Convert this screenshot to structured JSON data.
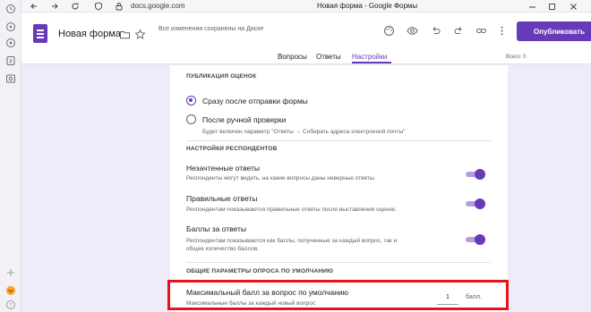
{
  "browser": {
    "url": "docs.google.com",
    "window_title": "Новая форма - Google Формы",
    "nav_icons": [
      "back-icon",
      "forward-icon",
      "refresh-icon",
      "shield-icon",
      "lock-icon"
    ],
    "sidebar_icons": [
      "history-icon",
      "messenger-icon",
      "play-icon",
      "bookmark-icon",
      "screenshot-icon",
      "add-icon",
      "extension-icon",
      "help-icon"
    ]
  },
  "header": {
    "title": "Новая форма",
    "saved_status": "Все изменения сохранены на Диске",
    "publish_label": "Опубликовать",
    "tabs": [
      {
        "label": "Вопросы",
        "active": false
      },
      {
        "label": "Ответы",
        "active": false
      },
      {
        "label": "Настройки",
        "active": true
      }
    ],
    "total_points": "Всего: 0",
    "accent_color": "#673ab7"
  },
  "settings": {
    "grading_section": "ПУБЛИКАЦИЯ ОЦЕНОК",
    "radio_immediately": "Сразу после отправки формы",
    "radio_manual": "После ручной проверки",
    "radio_manual_hint": "Будет включен параметр \"Ответы → Собирать адреса электронной почты\"",
    "respondent_section": "НАСТРОЙКИ РЕСПОНДЕНТОВ",
    "missed_title": "Незачтенные ответы",
    "missed_desc": "Респонденты могут видеть, на какие вопросы даны неверные ответы.",
    "correct_title": "Правильные ответы",
    "correct_desc": "Респондентам показываются правильные ответы после выставления оценок.",
    "points_title": "Баллы за ответы",
    "points_desc_1": "Респондентам показываются как баллы, полученные за каждый вопрос, так и",
    "points_desc_2": "общее количество баллов.",
    "defaults_section": "ОБЩИЕ ПАРАМЕТРЫ ОПРОСА ПО УМОЛЧАНИЮ",
    "max_points_title": "Максимальный балл за вопрос по умолчанию",
    "max_points_desc": "Максимальные баллы за каждый новый вопрос",
    "max_points_value": "1",
    "max_points_unit": "балл."
  }
}
